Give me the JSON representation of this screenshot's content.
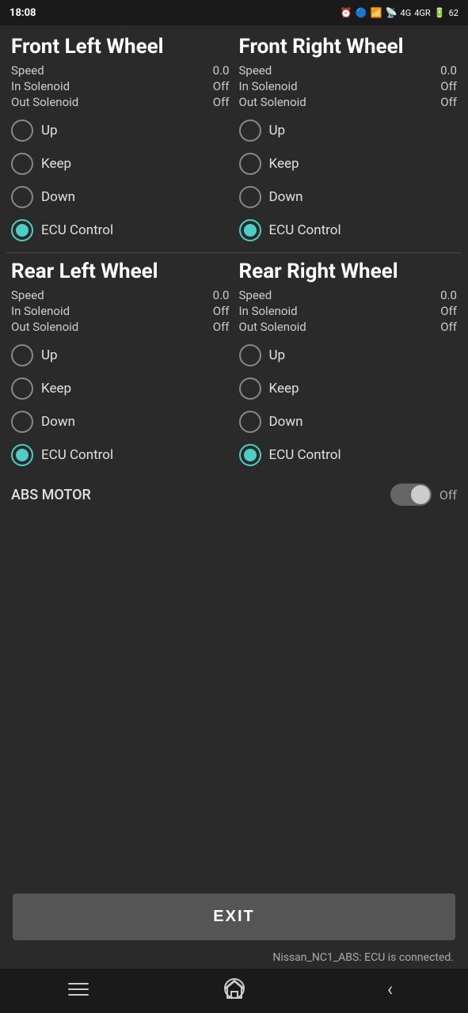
{
  "statusBar": {
    "time": "18:08",
    "rightIcons": "⏰ 🔵 📶 📡 4G 4GR 🔋 62"
  },
  "wheels": [
    {
      "id": "front-left",
      "title": "Front Left Wheel",
      "speed": "0.0",
      "inSolenoid": "Off",
      "outSolenoid": "Off",
      "options": [
        "Up",
        "Keep",
        "Down",
        "ECU Control"
      ],
      "selected": "ECU Control"
    },
    {
      "id": "front-right",
      "title": "Front Right Wheel",
      "speed": "0.0",
      "inSolenoid": "Off",
      "outSolenoid": "Off",
      "options": [
        "Up",
        "Keep",
        "Down",
        "ECU Control"
      ],
      "selected": "ECU Control"
    },
    {
      "id": "rear-left",
      "title": "Rear Left Wheel",
      "speed": "0.0",
      "inSolenoid": "Off",
      "outSolenoid": "Off",
      "options": [
        "Up",
        "Keep",
        "Down",
        "ECU Control"
      ],
      "selected": "ECU Control"
    },
    {
      "id": "rear-right",
      "title": "Rear Right Wheel",
      "speed": "0.0",
      "inSolenoid": "Off",
      "outSolenoid": "Off",
      "options": [
        "Up",
        "Keep",
        "Down",
        "ECU Control"
      ],
      "selected": "ECU Control"
    }
  ],
  "labels": {
    "speed": "Speed",
    "inSolenoid": "In Solenoid",
    "outSolenoid": "Out Solenoid",
    "absMotor": "ABS MOTOR",
    "absMotorValue": "Off",
    "exit": "EXIT",
    "ecuStatus": "Nissan_NC1_ABS: ECU is connected."
  }
}
